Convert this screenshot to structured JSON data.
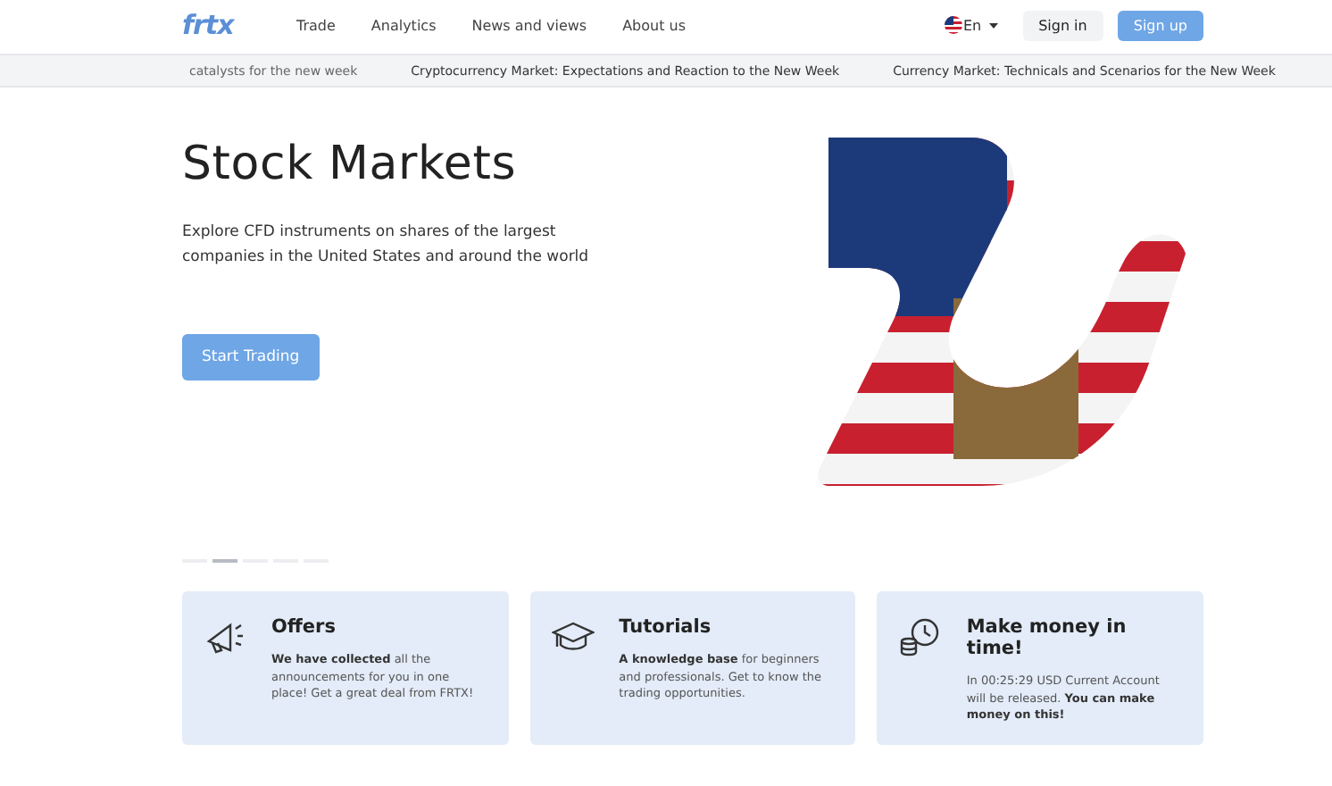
{
  "header": {
    "logo": "frtx",
    "nav": [
      {
        "label": "Trade"
      },
      {
        "label": "Analytics"
      },
      {
        "label": "News and views"
      },
      {
        "label": "About us"
      }
    ],
    "language": "En",
    "sign_in": "Sign in",
    "sign_up": "Sign up"
  },
  "ticker": {
    "items": [
      "catalysts for the new week",
      "Cryptocurrency Market: Expectations and Reaction to the New Week",
      "Currency Market: Technicals and Scenarios for the New Week"
    ]
  },
  "hero": {
    "title": "Stock Markets",
    "description": "Explore CFD instruments on shares of the largest companies in the United States and around the world",
    "button": "Start Trading",
    "slides": [
      {
        "selected": false
      },
      {
        "selected": true
      },
      {
        "selected": false
      },
      {
        "selected": false
      },
      {
        "selected": false
      }
    ]
  },
  "cards": [
    {
      "kind": "offers",
      "title": "Offers",
      "text": "**We have collected** all the announcements for you in one place! Get a great deal from FRTX!"
    },
    {
      "kind": "tutorials",
      "title": "Tutorials",
      "text": "**A knowledge base** for beginners and professionals. Get to know the trading opportunities."
    },
    {
      "kind": "money",
      "title": "Make money in time!",
      "text": "In 00:25:29 USD Current Account will be released. **You can make money on this!**"
    }
  ]
}
